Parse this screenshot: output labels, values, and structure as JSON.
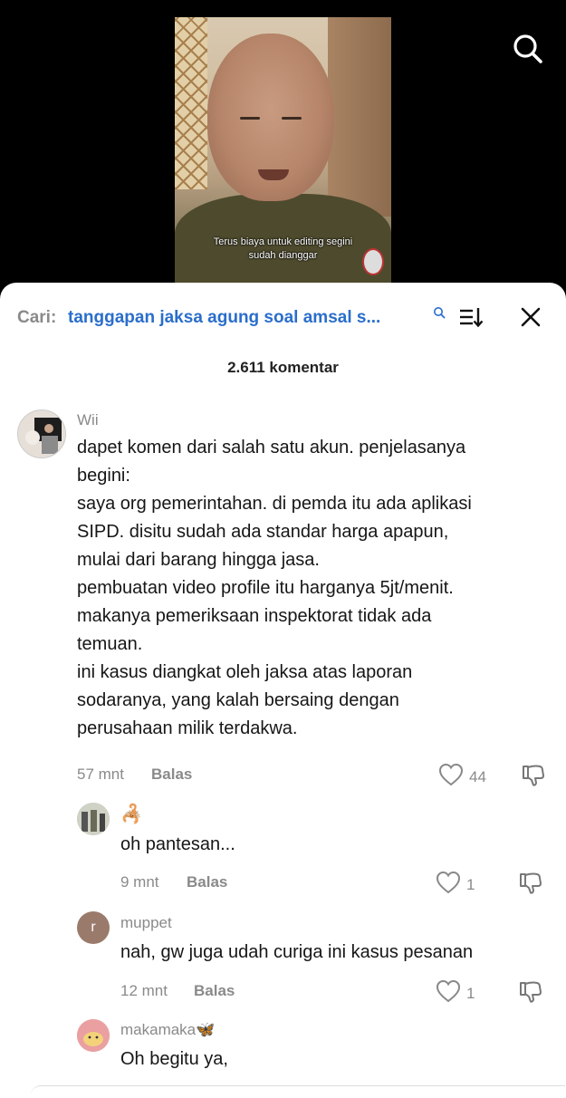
{
  "video": {
    "subtitle_line1": "Terus biaya untuk editing segini",
    "subtitle_line2": "sudah dianggar"
  },
  "search_bar": {
    "label": "Cari:",
    "query": "tanggapan jaksa agung soal amsal s..."
  },
  "comments_count": "2.611 komentar",
  "comments": [
    {
      "username": "Wii",
      "text": "dapet komen dari salah satu akun. penjelasanya\nbegini:\nsaya org pemerintahan. di pemda itu ada aplikasi\nSIPD. disitu sudah ada standar harga apapun,\nmulai dari barang hingga jasa.\npembuatan video profile itu harganya 5jt/menit.\nmakanya pemeriksaan inspektorat tidak ada\ntemuan.\nini kasus diangkat oleh jaksa atas laporan\nsodaranya, yang kalah bersaing dengan\nperusahaan milik terdakwa.",
      "time": "57 mnt",
      "reply_label": "Balas",
      "likes": "44"
    },
    {
      "username": "",
      "username_emoji": "🦂",
      "text": "oh pantesan...",
      "time": "9 mnt",
      "reply_label": "Balas",
      "likes": "1"
    },
    {
      "username": "muppet",
      "avatar_letter": "r",
      "text": "nah, gw juga udah curiga ini kasus pesanan",
      "time": "12 mnt",
      "reply_label": "Balas",
      "likes": "1"
    },
    {
      "username": "makamaka",
      "username_emoji": "🦋",
      "text": "Oh begitu ya,"
    }
  ],
  "colors": {
    "query_blue": "#2a6ecb",
    "muted_gray": "#8a8a8a",
    "text_dark": "#161616",
    "muppet_avatar": "#9a7a6a"
  },
  "icons": [
    "search-icon",
    "sort-icon",
    "close-icon",
    "heart-icon",
    "dislike-icon"
  ]
}
